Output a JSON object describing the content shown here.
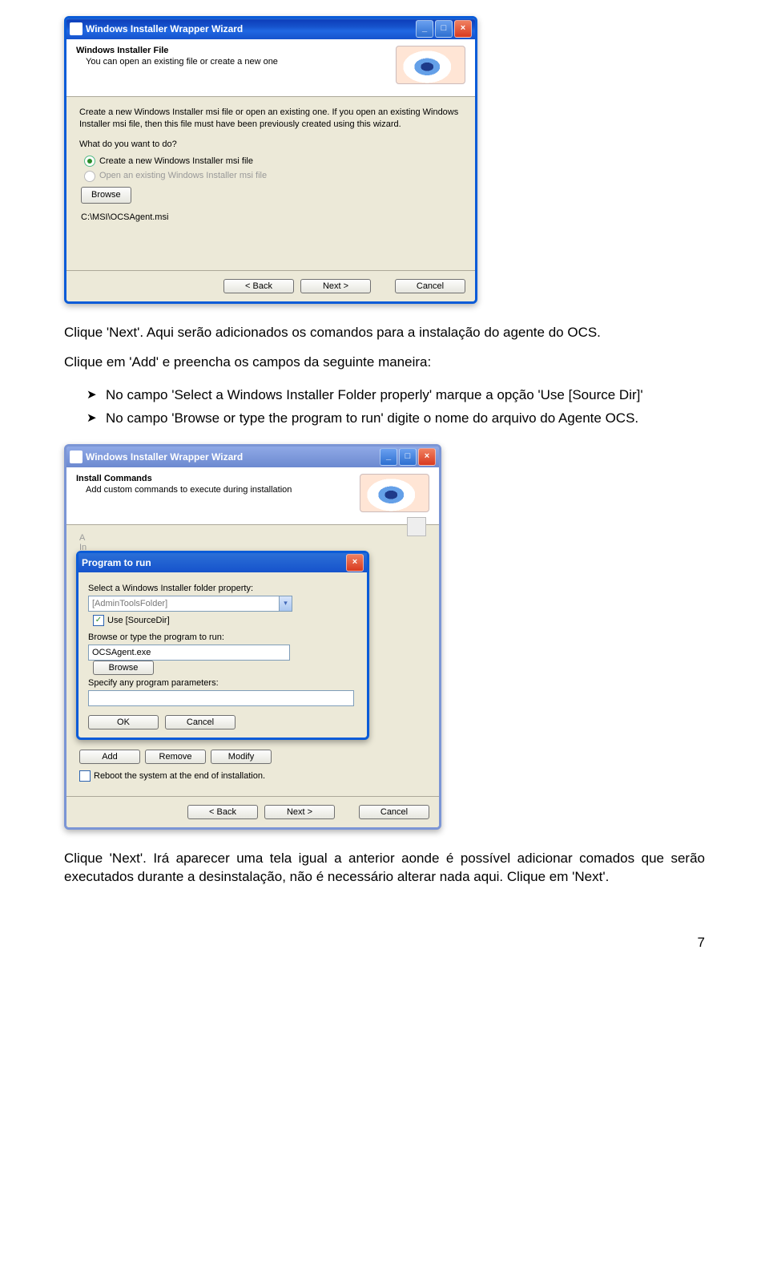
{
  "dialog1": {
    "title": "Windows Installer Wrapper Wizard",
    "header_title": "Windows Installer File",
    "header_sub": "You can open an existing file or create a new one",
    "desc": "Create a new Windows Installer msi file or open an existing one. If you open an existing Windows Installer msi file, then this file must have been previously created using this wizard.",
    "question": "What do you want to do?",
    "opt_create": "Create a new Windows Installer msi file",
    "opt_open": "Open an existing Windows Installer msi file",
    "browse": "Browse",
    "path": "C:\\MSI\\OCSAgent.msi",
    "back": "< Back",
    "next": "Next >",
    "cancel": "Cancel"
  },
  "para1": "Clique 'Next'. Aqui serão adicionados os comandos para a instalação do agente do OCS.",
  "para2": "Clique em 'Add' e preencha os campos da seguinte maneira:",
  "bullet1": "No campo 'Select a Windows Installer Folder properly' marque a opção 'Use [Source Dir]'",
  "bullet2": "No campo 'Browse or type the program to run' digite o nome do arquivo do Agente OCS.",
  "dialog2": {
    "title": "Windows Installer Wrapper Wizard",
    "header_title": "Install Commands",
    "header_sub": "Add custom commands to execute during installation",
    "colA_hint": "A",
    "colB_hint": "In",
    "modal_title": "Program to run",
    "sel_label": "Select a Windows Installer folder property:",
    "sel_value": "[AdminToolsFolder]",
    "use_sourcedir": "Use [SourceDir]",
    "browse_label": "Browse or type the program to run:",
    "program_value": "OCSAgent.exe",
    "browse": "Browse",
    "params_label": "Specify any program parameters:",
    "ok": "OK",
    "cancel": "Cancel",
    "add": "Add",
    "remove": "Remove",
    "modify": "Modify",
    "reboot": "Reboot the system at the end of installation.",
    "back": "< Back",
    "next": "Next >",
    "cancel2": "Cancel"
  },
  "para3": "Clique 'Next'. Irá aparecer uma tela igual a anterior aonde é possível adicionar comados que serão executados durante a desinstalação, não é necessário alterar nada aqui. Clique em 'Next'.",
  "page_number": "7"
}
